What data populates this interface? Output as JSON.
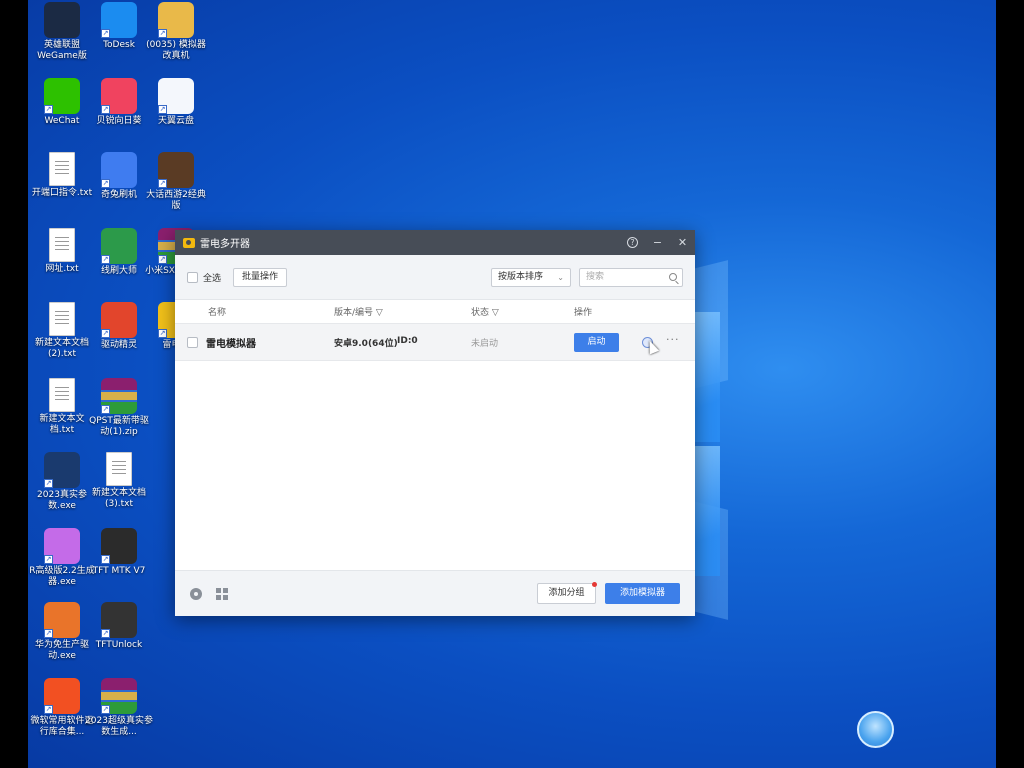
{
  "desktop": {
    "icons": [
      {
        "label": "英雄联盟WeGame版",
        "icon": "lol-icon",
        "bg": "#1b2a44",
        "kind": "app"
      },
      {
        "label": "ToDesk",
        "icon": "todesk-icon",
        "bg": "#1b8cf0",
        "kind": "app"
      },
      {
        "label": "(0035) 模拟器改真机",
        "icon": "folder-icon",
        "bg": "#e9b949",
        "kind": "app"
      },
      {
        "label": "WeChat",
        "icon": "wechat-icon",
        "bg": "#2dc100",
        "kind": "app"
      },
      {
        "label": "贝锐向日葵",
        "icon": "sunlogin-icon",
        "bg": "#f0435f",
        "kind": "app"
      },
      {
        "label": "天翼云盘",
        "icon": "cloud-icon",
        "bg": "#f4f7fc",
        "kind": "app"
      },
      {
        "label": "开端口指令.txt",
        "icon": "text-file-icon",
        "bg": "#ffffff",
        "kind": "txt"
      },
      {
        "label": "奇兔刷机",
        "icon": "rabbit-icon",
        "bg": "#3f7cf0",
        "kind": "app"
      },
      {
        "label": "大话西游2经典版",
        "icon": "game-icon",
        "bg": "#5a3b24",
        "kind": "app"
      },
      {
        "label": "网址.txt",
        "icon": "text-file-icon",
        "bg": "#ffffff",
        "kind": "txt"
      },
      {
        "label": "线刷大师",
        "icon": "android-icon",
        "bg": "#2c9a4a",
        "kind": "app"
      },
      {
        "label": "小米SX刷入rec",
        "icon": "archive-icon",
        "bg": "#8b1f6e",
        "kind": "rar"
      },
      {
        "label": "新建文本文档(2).txt",
        "icon": "text-file-icon",
        "bg": "#ffffff",
        "kind": "txt"
      },
      {
        "label": "驱动精灵",
        "icon": "driver-icon",
        "bg": "#e2452c",
        "kind": "app"
      },
      {
        "label": "雷电多",
        "icon": "ldplayer-icon",
        "bg": "#f3c21a",
        "kind": "app"
      },
      {
        "label": "新建文本文档.txt",
        "icon": "text-file-icon",
        "bg": "#ffffff",
        "kind": "txt"
      },
      {
        "label": "QPST最新带驱动(1).zip",
        "icon": "archive-icon",
        "bg": "#8b1f6e",
        "kind": "rar"
      },
      {
        "label": "2023真实参数.exe",
        "icon": "exe-icon",
        "bg": "#1a3a6e",
        "kind": "app"
      },
      {
        "label": "新建文本文档(3).txt",
        "icon": "text-file-icon",
        "bg": "#ffffff",
        "kind": "txt"
      },
      {
        "label": "R高级版2.2生成器.exe",
        "icon": "purple-app-icon",
        "bg": "#c46be8",
        "kind": "app"
      },
      {
        "label": "TFT MTK V7",
        "icon": "tft-icon",
        "bg": "#2b2b2b",
        "kind": "app"
      },
      {
        "label": "华为免生产驱动.exe",
        "icon": "huawei-icon",
        "bg": "#e9742a",
        "kind": "app"
      },
      {
        "label": "TFTUnlock",
        "icon": "tft-unlock-icon",
        "bg": "#333333",
        "kind": "app"
      },
      {
        "label": "微软常用软件运行库合集...",
        "icon": "windows-icon",
        "bg": "#f25022",
        "kind": "app"
      },
      {
        "label": "2023超级真实参数生成...",
        "icon": "archive-icon",
        "bg": "#8b1f6e",
        "kind": "rar"
      }
    ]
  },
  "window": {
    "title": "雷电多开器",
    "toolbar": {
      "select_all": "全选",
      "batch_ops": "批量操作",
      "sort": "按版本排序",
      "search_placeholder": "搜索"
    },
    "columns": {
      "name": "名称",
      "version": "版本/编号",
      "status": "状态",
      "actions": "操作"
    },
    "rows": [
      {
        "name": "雷电模拟器",
        "version": "安卓9.0(64位)",
        "id": "ID:0",
        "status": "未启动",
        "start": "启动",
        "more": "···"
      }
    ],
    "footer": {
      "add_group": "添加分组",
      "add_emulator": "添加模拟器"
    },
    "colors": {
      "accent": "#3d7fe9",
      "titlebar": "#474d57"
    }
  }
}
